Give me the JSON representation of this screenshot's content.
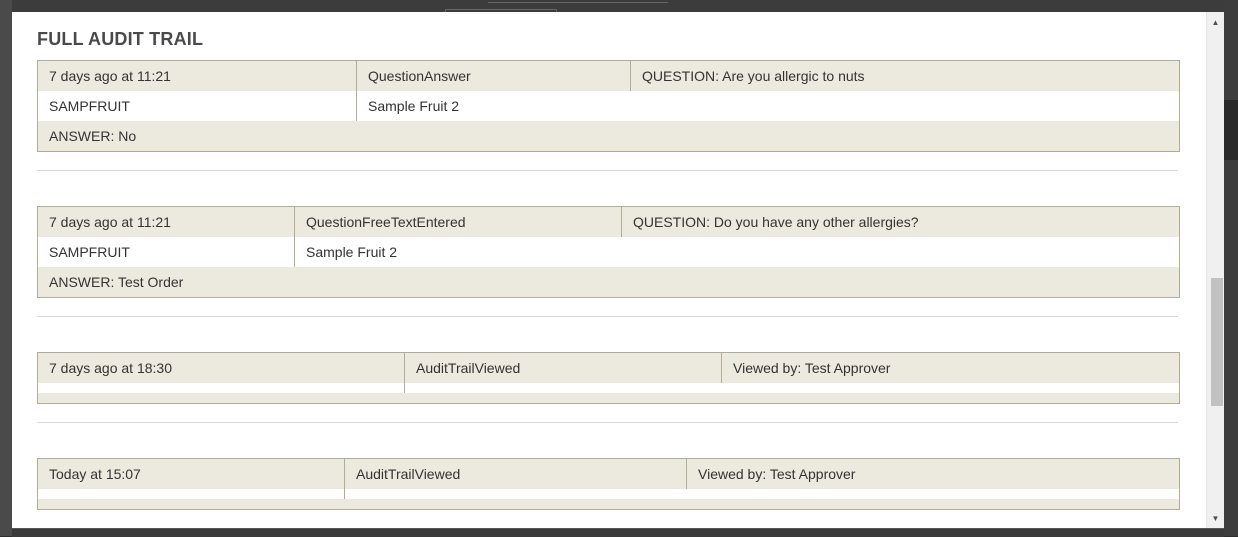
{
  "modal": {
    "title": "FULL AUDIT TRAIL"
  },
  "entries": [
    {
      "time": "7 days ago at 11:21",
      "event": "QuestionAnswer",
      "detail": "QUESTION: Are you allergic to nuts",
      "code": "SAMPFRUIT",
      "product": "Sample Fruit 2",
      "answer": "ANSWER: No"
    },
    {
      "time": "7 days ago at 11:21",
      "event": "QuestionFreeTextEntered",
      "detail": "QUESTION: Do you have any other allergies?",
      "code": "SAMPFRUIT",
      "product": "Sample Fruit 2",
      "answer": "ANSWER: Test Order"
    },
    {
      "time": "7 days ago at 18:30",
      "event": "AuditTrailViewed",
      "detail": "Viewed by: Test Approver"
    },
    {
      "time": "Today at 15:07",
      "event": "AuditTrailViewed",
      "detail": "Viewed by: Test Approver"
    }
  ],
  "icons": {
    "scroll_up": "triangle-up-icon",
    "scroll_down": "triangle-down-icon"
  },
  "colors": {
    "row_band": "#ece9de",
    "border": "#b3ab96",
    "title": "#4a4a4a"
  }
}
